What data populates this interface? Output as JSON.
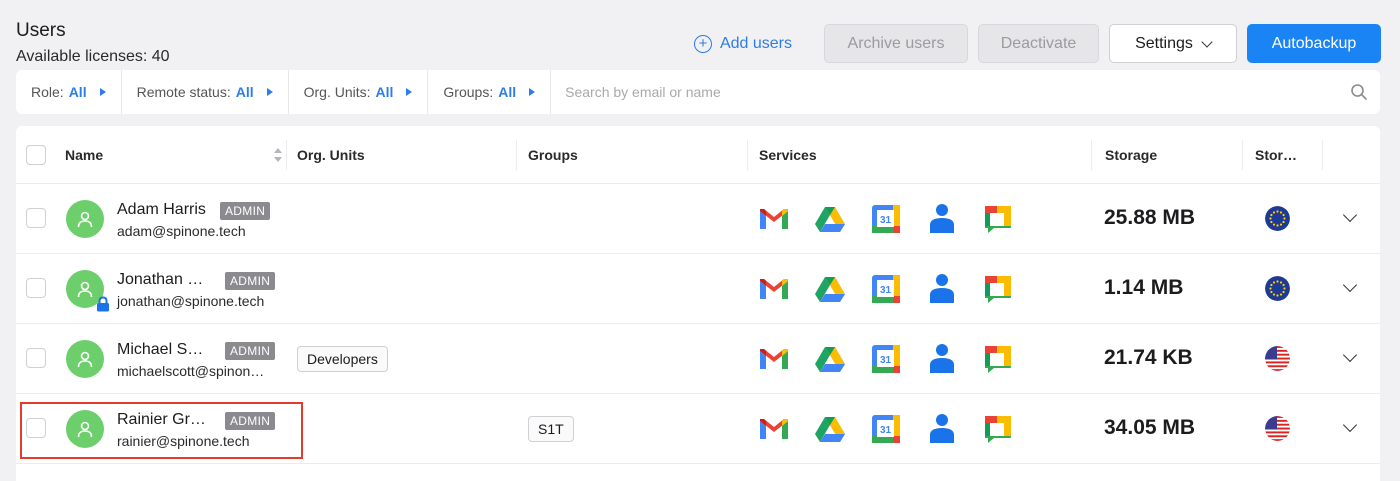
{
  "header": {
    "title": "Users",
    "subtitle": "Available licenses: 40"
  },
  "toolbar": {
    "add_users": "Add users",
    "archive_users": "Archive users",
    "deactivate": "Deactivate",
    "settings": "Settings",
    "autobackup": "Autobackup"
  },
  "filters": [
    {
      "label": "Role:",
      "value": "All"
    },
    {
      "label": "Remote status:",
      "value": "All"
    },
    {
      "label": "Org. Units:",
      "value": "All"
    },
    {
      "label": "Groups:",
      "value": "All"
    }
  ],
  "search": {
    "placeholder": "Search by email or name"
  },
  "columns": {
    "name": "Name",
    "org_units": "Org. Units",
    "groups": "Groups",
    "services": "Services",
    "storage": "Storage",
    "stor": "Stor…"
  },
  "rows": [
    {
      "name": "Adam Harris",
      "badge": "ADMIN",
      "email": "adam@spinone.tech",
      "org_unit": "",
      "group": "",
      "storage": "25.88 MB",
      "region": "eu",
      "locked": false
    },
    {
      "name": "Jonathan …",
      "badge": "ADMIN",
      "email": "jonathan@spinone.tech",
      "org_unit": "",
      "group": "",
      "storage": "1.14 MB",
      "region": "eu",
      "locked": true
    },
    {
      "name": "Michael S…",
      "badge": "ADMIN",
      "email": "michaelscott@spinon…",
      "org_unit": "Developers",
      "group": "",
      "storage": "21.74 KB",
      "region": "us",
      "locked": false
    },
    {
      "name": "Rainier Gr…",
      "badge": "ADMIN",
      "email": "rainier@spinone.tech",
      "org_unit": "",
      "group": "S1T",
      "storage": "34.05 MB",
      "region": "us",
      "locked": false
    }
  ],
  "service_icons": [
    "gmail-icon",
    "google-drive-icon",
    "google-calendar-icon",
    "google-contacts-icon",
    "google-chat-icon"
  ],
  "calendar_icon_day": "31",
  "colors": {
    "accent": "#1a84f5",
    "link": "#2b7de9",
    "avatar": "#6ccf6b",
    "badge": "#8a8a8f",
    "highlight": "#e53b2c"
  }
}
